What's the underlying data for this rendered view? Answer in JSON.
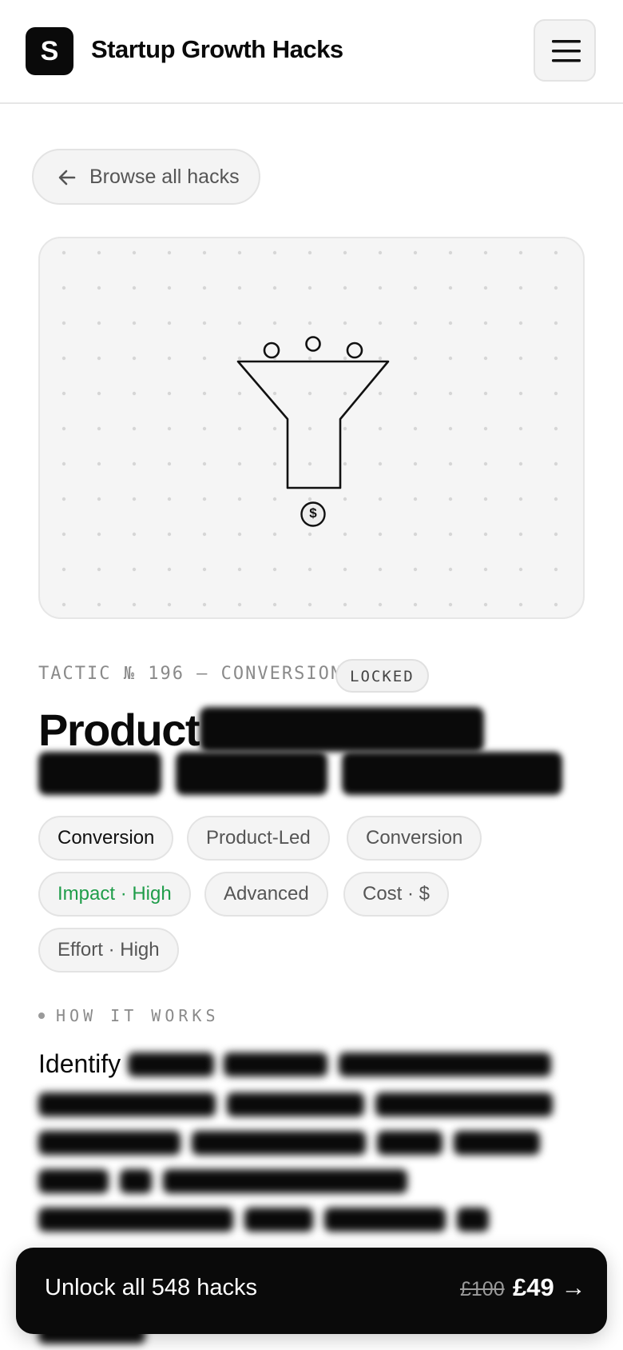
{
  "header": {
    "logo_letter": "S",
    "brand": "Startup Growth Hacks",
    "menu_icon": "hamburger-menu-icon"
  },
  "nav": {
    "back_label": "Browse all hacks",
    "back_icon": "arrow-left-icon"
  },
  "illustration": {
    "icon": "funnel-icon",
    "coin_symbol": "$"
  },
  "tactic": {
    "meta": "TACTIC № 196 — CONVERSION",
    "status": "LOCKED",
    "title_visible": "Product"
  },
  "tags": [
    {
      "label": "Conversion"
    },
    {
      "label": "Product-Led"
    },
    {
      "label": "Conversion"
    },
    {
      "label": "Impact · High"
    },
    {
      "label": "Advanced"
    },
    {
      "label": "Cost · $"
    },
    {
      "label": "Effort · High"
    }
  ],
  "section": {
    "label": "HOW IT WORKS",
    "first_word": "Identify"
  },
  "cta": {
    "label": "Unlock all 548 hacks",
    "old_price": "£100",
    "price": "£49 →"
  },
  "colors": {
    "accent_dark": "#0a0a0a",
    "impact_green": "#1f9d4a",
    "panel_bg": "#f5f5f5"
  }
}
